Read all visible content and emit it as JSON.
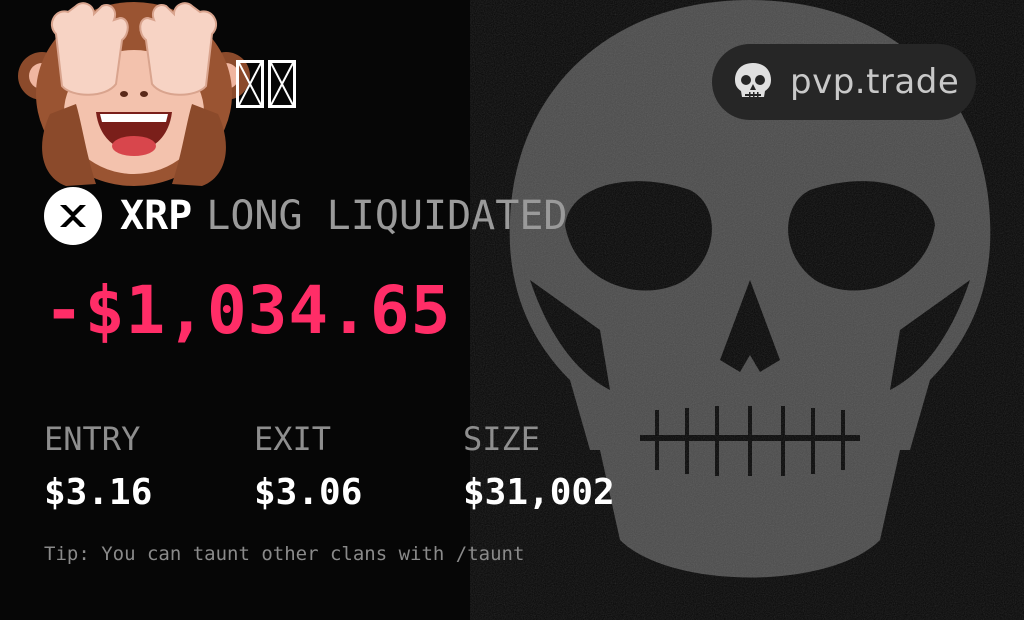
{
  "brand": {
    "name": "pvp.trade",
    "icon": "skull-icon"
  },
  "header": {
    "emoji": "see-no-evil-monkey",
    "missing_glyphs": 2
  },
  "trade": {
    "asset": "XRP",
    "status": "LONG LIQUIDATED",
    "pnl": "-$1,034.65",
    "pnl_color": "#ff2d67"
  },
  "stats": [
    {
      "label": "ENTRY",
      "value": "$3.16"
    },
    {
      "label": "EXIT",
      "value": "$3.06"
    },
    {
      "label": "SIZE",
      "value": "$31,002"
    }
  ],
  "tip": "Tip: You can taunt other clans with /taunt"
}
